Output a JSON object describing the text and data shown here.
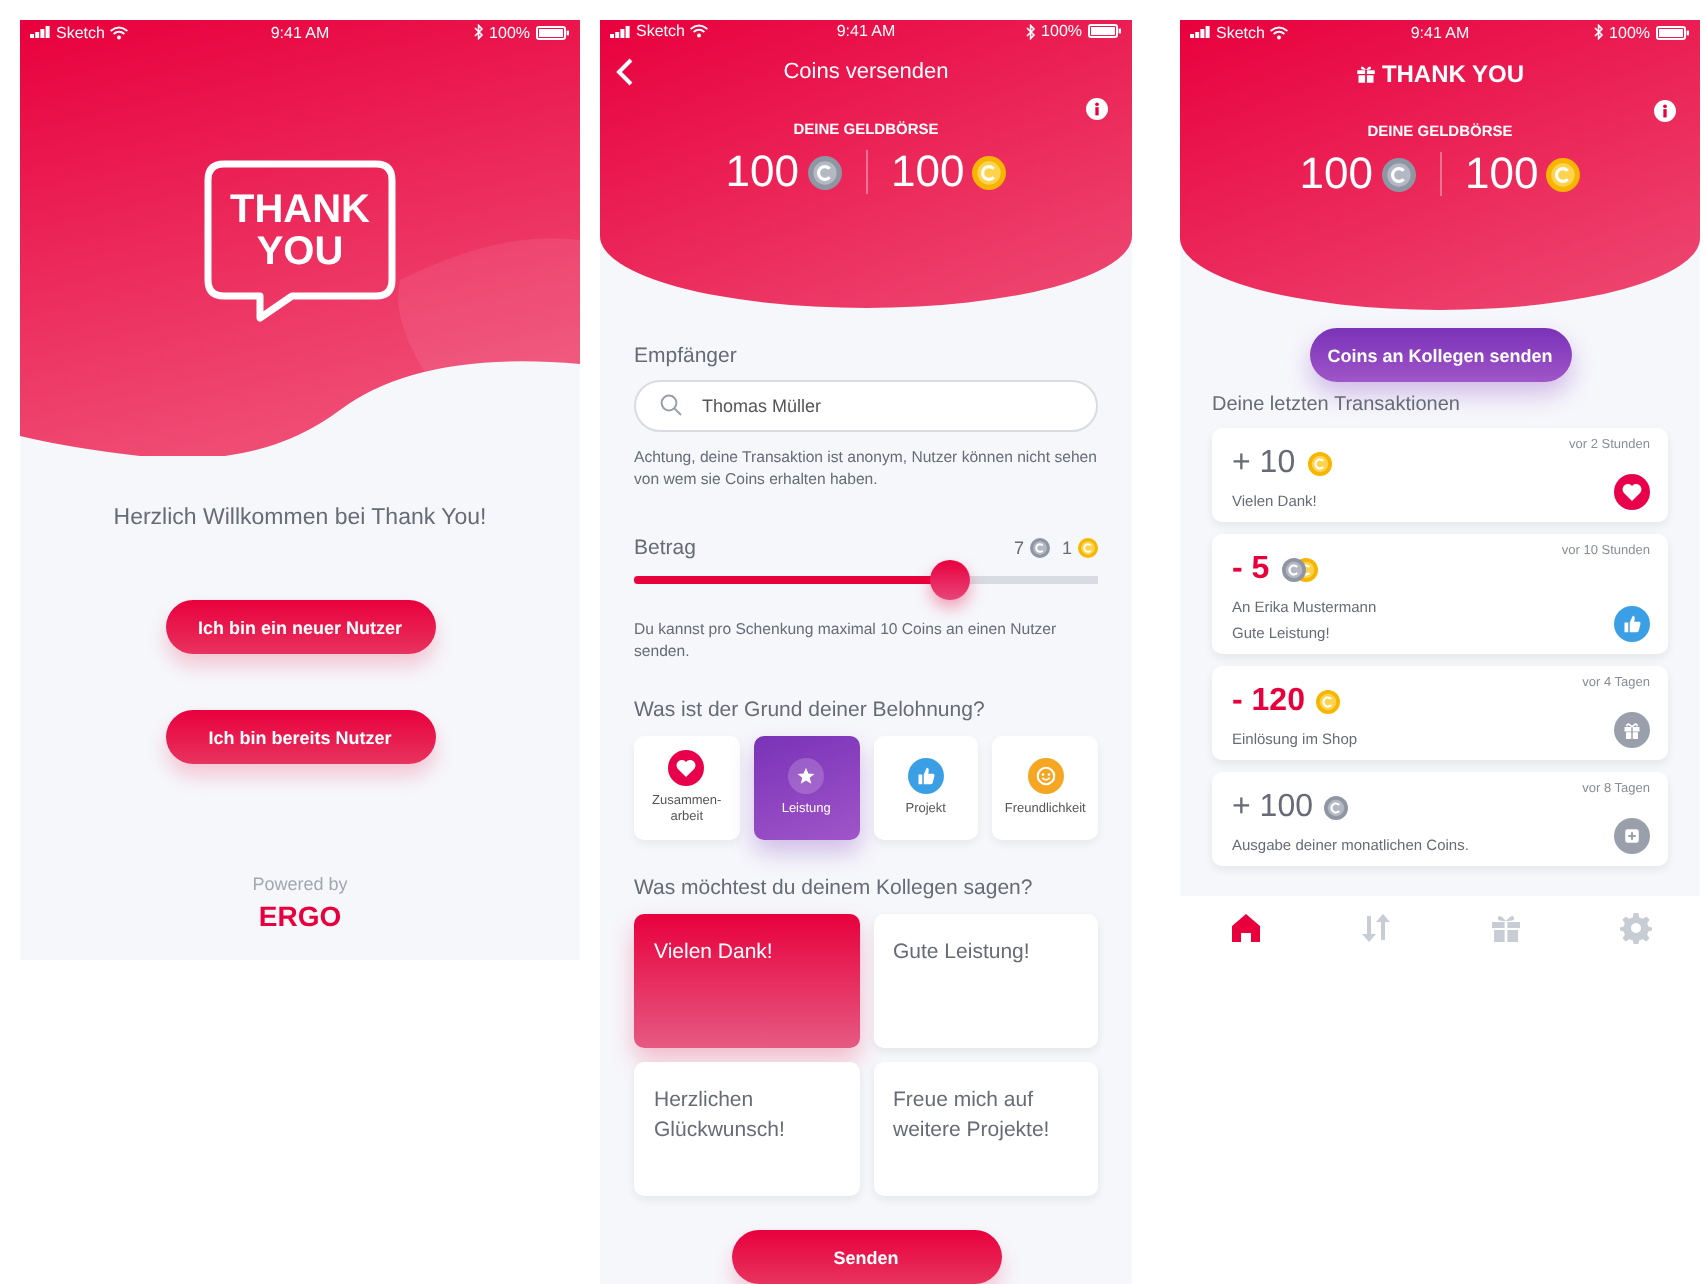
{
  "screens": [
    {
      "kind": "welcome",
      "status_bar": {
        "carrier": "Sketch",
        "time": "9:41 AM",
        "battery": "100%"
      },
      "logo": [
        "THANK",
        "YOU"
      ],
      "greeting": "Herzlich Willkommen bei Thank You!",
      "buttons": [
        "Ich bin ein neuer Nutzer",
        "Ich bin bereits Nutzer"
      ],
      "powered_by": "Powered by",
      "brand": "ERGO"
    },
    {
      "kind": "send",
      "status_bar": {
        "carrier": "Sketch",
        "time": "9:41 AM",
        "battery": "100%"
      },
      "title": "Coins versenden",
      "wallet": {
        "label": "DEINE GELDBÖRSE",
        "silver": "100",
        "gold": "100"
      },
      "recipient_label": "Empfänger",
      "recipient_value": "Thomas Müller",
      "notice": "Achtung, deine Transaktion ist anonym, Nutzer können nicht sehen von wem sie Coins erhalten haben.",
      "amount": {
        "label": "Betrag",
        "silver": "7",
        "gold": "1",
        "level": 0.68
      },
      "hint": "Du kannst pro Schenkung maximal 10 Coins an einen Nutzer senden.",
      "reason_question": "Was ist der Grund deiner Belohnung?",
      "reasons": [
        {
          "label": "Zusammen-\narbeit",
          "kind": "heart",
          "selected": false
        },
        {
          "label": "Leistung",
          "kind": "star",
          "selected": true
        },
        {
          "label": "Projekt",
          "kind": "thumb",
          "selected": false
        },
        {
          "label": "Freundlichkeit",
          "kind": "smile",
          "selected": false
        }
      ],
      "message_question": "Was möchtest du deinem Kollegen sagen?",
      "messages": [
        {
          "text": "Vielen Dank!",
          "selected": true
        },
        {
          "text": "Gute Leistung!",
          "selected": false
        },
        {
          "text": "Herzlichen Glückwunsch!",
          "selected": false
        },
        {
          "text": "Freue mich auf weitere Projekte!",
          "selected": false
        }
      ],
      "send_button": "Senden"
    },
    {
      "kind": "home",
      "status_bar": {
        "carrier": "Sketch",
        "time": "9:41 AM",
        "battery": "100%"
      },
      "title": "THANK YOU",
      "wallet": {
        "label": "DEINE GELDBÖRSE",
        "silver": "100",
        "gold": "100"
      },
      "send_button": "Coins an Kollegen senden",
      "section_title": "Deine letzten Transaktionen",
      "transactions": [
        {
          "amount": "+ 10",
          "negative": false,
          "coins": [
            {
              "kind": "gold"
            }
          ],
          "time": "vor 2 Stunden",
          "lines": [
            "Vielen Dank!"
          ],
          "kind": "heart"
        },
        {
          "amount": "- 5",
          "negative": true,
          "coins": [
            {
              "kind": "silver"
            },
            {
              "kind": "gold"
            }
          ],
          "time": "vor 10 Stunden",
          "lines": [
            "An Erika Mustermann",
            "Gute Leistung!"
          ],
          "kind": "thumb"
        },
        {
          "amount": "- 120",
          "negative": true,
          "coins": [
            {
              "kind": "gold"
            }
          ],
          "time": "vor 4 Tagen",
          "lines": [
            "Einlösung im Shop"
          ],
          "kind": "gift"
        },
        {
          "amount": "+ 100",
          "negative": false,
          "coins": [
            {
              "kind": "silver"
            }
          ],
          "time": "vor 8 Tagen",
          "lines": [
            "Ausgabe deiner monatlichen Coins."
          ],
          "kind": "plus"
        }
      ],
      "tabs": [
        {
          "kind": "home",
          "selected": true
        },
        {
          "kind": "transfer",
          "selected": false
        },
        {
          "kind": "gift",
          "selected": false
        },
        {
          "kind": "settings",
          "selected": false
        }
      ]
    }
  ]
}
